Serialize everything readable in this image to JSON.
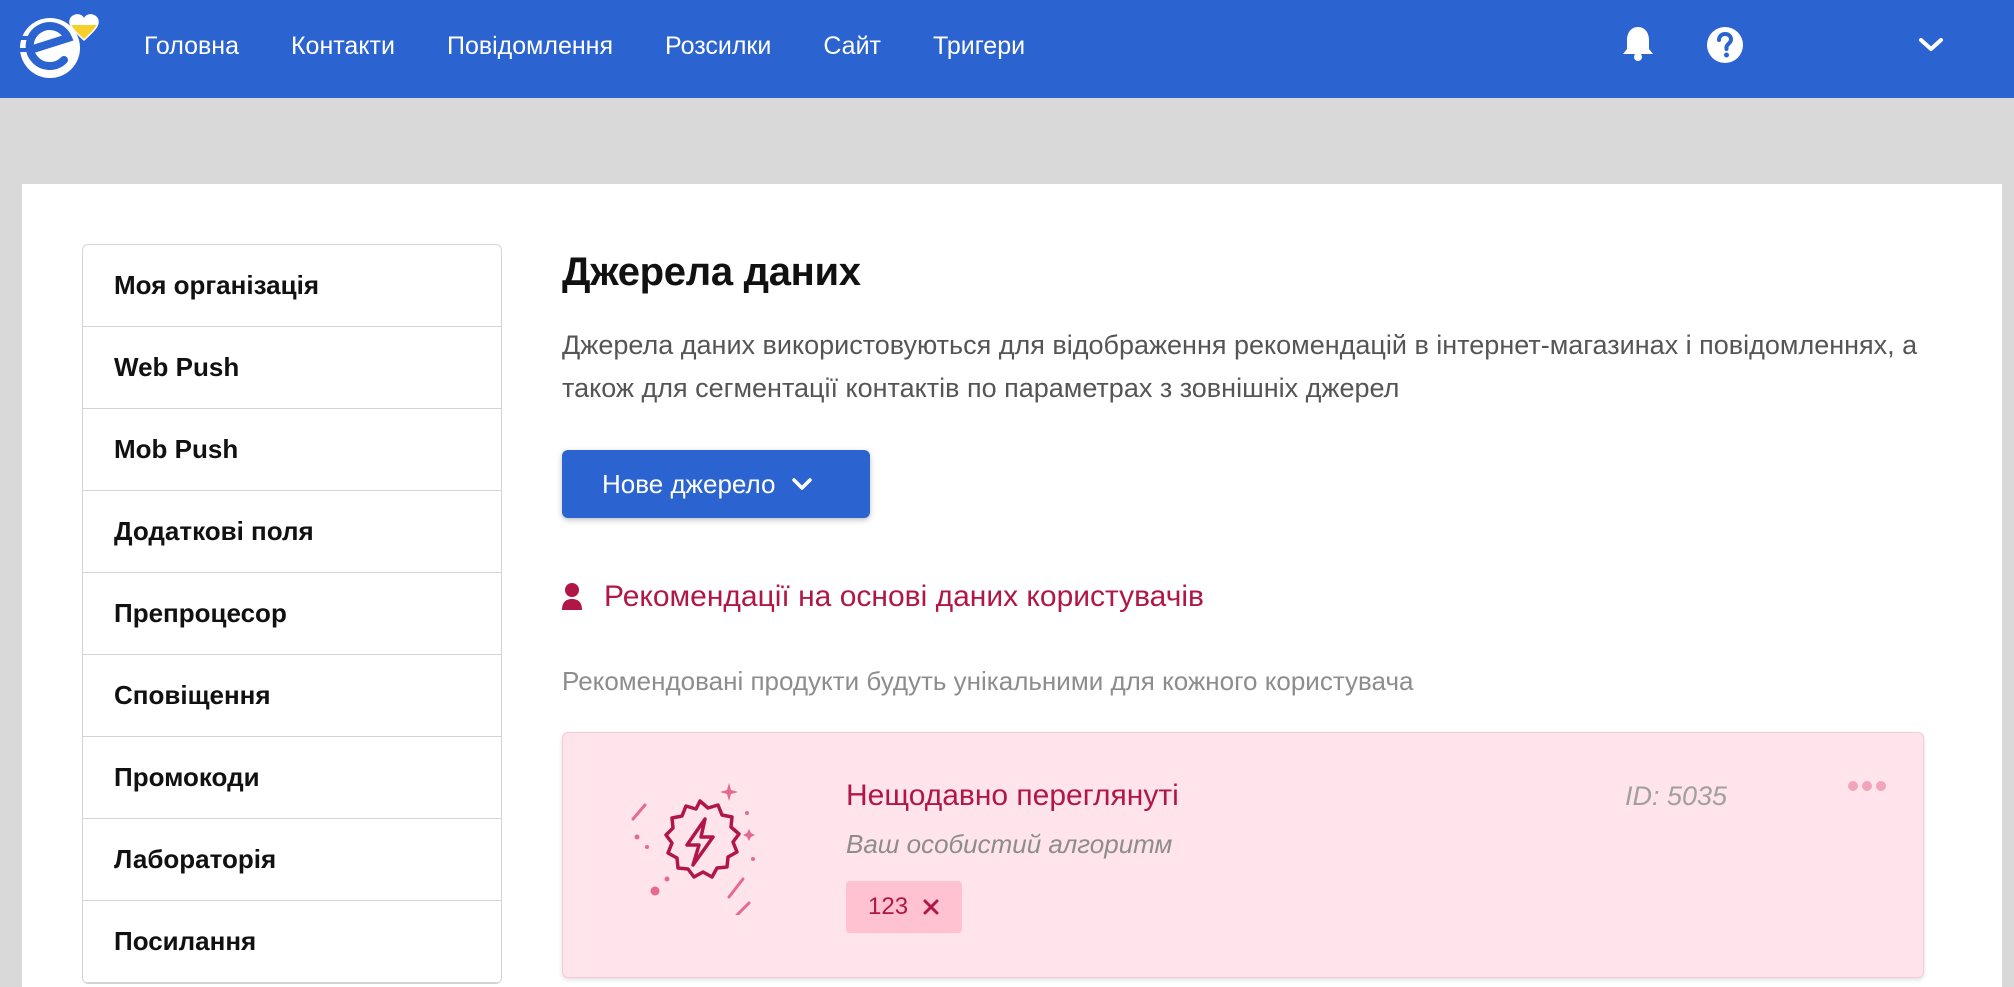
{
  "nav": {
    "items": [
      "Головна",
      "Контакти",
      "Повідомлення",
      "Розсилки",
      "Сайт",
      "Тригери"
    ]
  },
  "icons": {
    "logo": "esputnik-logo-with-heart",
    "notifications": "bell-icon",
    "help": "question-circle-icon",
    "account_menu": "chevron-down-icon"
  },
  "sidebar": {
    "items": [
      {
        "label": "Моя організація"
      },
      {
        "label": "Web Push"
      },
      {
        "label": "Mob Push"
      },
      {
        "label": "Додаткові поля"
      },
      {
        "label": "Препроцесор"
      },
      {
        "label": "Сповіщення"
      },
      {
        "label": "Промокоди"
      },
      {
        "label": "Лабораторія"
      },
      {
        "label": "Посилання"
      }
    ]
  },
  "main": {
    "title": "Джерела даних",
    "description": "Джерела даних використовуються для відображення рекомендацій в інтернет-магазинах і повідомленнях, а також для сегментації контактів по параметрах з зовнішніх джерел",
    "new_source_button": "Нове джерело",
    "section": {
      "icon": "user-icon",
      "title": "Рекомендації на основі даних користувачів",
      "subtitle": "Рекомендовані продукти будуть унікальними для кожного користувача"
    },
    "recommendation": {
      "title": "Нещодавно переглянуті",
      "subtitle": "Ваш особистий алгоритм",
      "id_text": "ID: 5035",
      "tag": "123",
      "icon": "lightning-badge-icon"
    }
  },
  "colors": {
    "brand_blue": "#2b63d0",
    "accent_red": "#b01747",
    "card_pink": "#ffe4eb",
    "tag_pink": "#ffc2d0"
  }
}
